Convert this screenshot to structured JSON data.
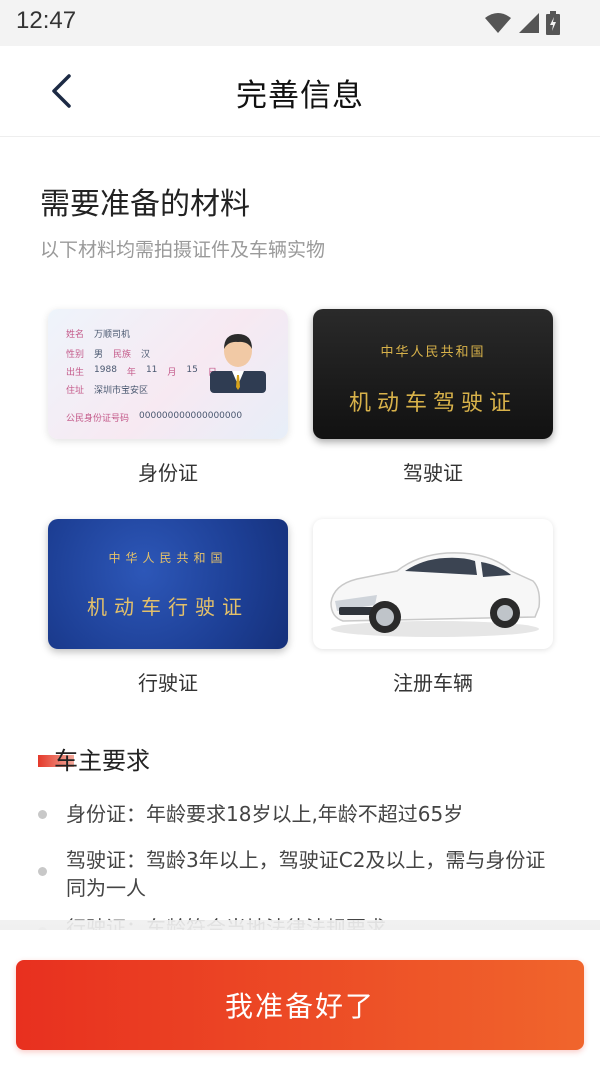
{
  "status_bar": {
    "time": "12:47",
    "icons": [
      "wifi-icon",
      "signal-icon",
      "battery-charging-icon"
    ]
  },
  "navbar": {
    "back_icon": "chevron-left-icon",
    "title": "完善信息"
  },
  "materials": {
    "heading": "需要准备的材料",
    "subheading": "以下材料均需拍摄证件及车辆实物",
    "items": [
      {
        "label": "身份证"
      },
      {
        "label": "驾驶证"
      },
      {
        "label": "行驶证"
      },
      {
        "label": "注册车辆"
      }
    ],
    "id_card": {
      "name_key": "姓名",
      "name_val": "万顺司机",
      "gender_key": "性别",
      "gender_val": "男",
      "ethnic_key": "民族",
      "ethnic_val": "汉",
      "birth_key": "出生",
      "year": "1988",
      "year_unit": "年",
      "month": "11",
      "month_unit": "月",
      "day": "15",
      "day_unit": "日",
      "addr_key": "住址",
      "addr_val": "深圳市宝安区",
      "idno_key": "公民身份证号码",
      "idno_val": "000000000000000000"
    },
    "driver_license": {
      "top": "中华人民共和国",
      "main": "机动车驾驶证"
    },
    "vehicle_license": {
      "top": "中华人民共和国",
      "main": "机动车行驶证"
    }
  },
  "owner_requirements": {
    "title": "车主要求",
    "items": [
      "身份证：年龄要求18岁以上,年龄不超过65岁",
      "驾驶证：驾龄3年以上，驾驶证C2及以上，需与身份证同为一人",
      "行驶证：车龄符合当地法律法规要求"
    ]
  },
  "cta": {
    "label": "我准备好了"
  },
  "colors": {
    "accent_start": "#e8301f",
    "accent_end": "#f0652c",
    "gold_text": "#d8b24a"
  }
}
